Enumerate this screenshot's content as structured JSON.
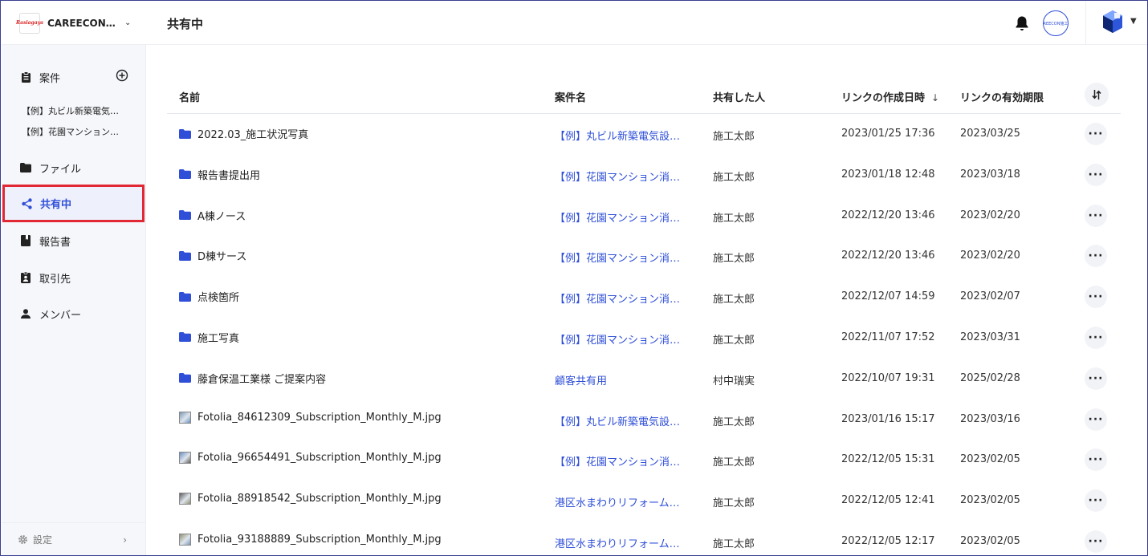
{
  "org": {
    "logo_text": "Rasiagaya",
    "name": "CAREECON 施…"
  },
  "sidebar": {
    "projects_label": "案件",
    "sub_items": [
      "【例】丸ビル新築電気設…",
      "【例】花園マンション…"
    ],
    "files_label": "ファイル",
    "shared_label": "共有中",
    "reports_label": "報告書",
    "clients_label": "取引先",
    "members_label": "メンバー",
    "settings_label": "設定"
  },
  "header": {
    "title": "共有中",
    "company_badge": "REECON施工"
  },
  "table": {
    "columns": [
      "名前",
      "案件名",
      "共有した人",
      "リンクの作成日時",
      "リンクの有効期限"
    ],
    "sort_indicator": "↓",
    "rows": [
      {
        "type": "folder",
        "name": "2022.03_施工状況写真",
        "project": "【例】丸ビル新築電気設備…",
        "shared_by": "施工太郎",
        "created": "2023/01/25 17:36",
        "expires": "2023/03/25"
      },
      {
        "type": "folder",
        "name": "報告書提出用",
        "project": "【例】花園マンション消防…",
        "shared_by": "施工太郎",
        "created": "2023/01/18 12:48",
        "expires": "2023/03/18"
      },
      {
        "type": "folder",
        "name": "A棟ノース",
        "project": "【例】花園マンション消防…",
        "shared_by": "施工太郎",
        "created": "2022/12/20 13:46",
        "expires": "2023/02/20"
      },
      {
        "type": "folder",
        "name": "D棟サース",
        "project": "【例】花園マンション消防…",
        "shared_by": "施工太郎",
        "created": "2022/12/20 13:46",
        "expires": "2023/02/20"
      },
      {
        "type": "folder",
        "name": "点検箇所",
        "project": "【例】花園マンション消防…",
        "shared_by": "施工太郎",
        "created": "2022/12/07 14:59",
        "expires": "2023/02/07"
      },
      {
        "type": "folder",
        "name": "施工写真",
        "project": "【例】花園マンション消防…",
        "shared_by": "施工太郎",
        "created": "2022/11/07 17:52",
        "expires": "2023/03/31"
      },
      {
        "type": "folder",
        "name": "藤倉保温工業様 ご提案内容",
        "project": "顧客共有用",
        "shared_by": "村中瑞実",
        "created": "2022/10/07 19:31",
        "expires": "2025/02/28"
      },
      {
        "type": "image",
        "name": "Fotolia_84612309_Subscription_Monthly_M.jpg",
        "project": "【例】丸ビル新築電気設備…",
        "shared_by": "施工太郎",
        "created": "2023/01/16 15:17",
        "expires": "2023/03/16"
      },
      {
        "type": "image",
        "name": "Fotolia_96654491_Subscription_Monthly_M.jpg",
        "project": "【例】花園マンション消防…",
        "shared_by": "施工太郎",
        "created": "2022/12/05 15:31",
        "expires": "2023/02/05"
      },
      {
        "type": "image",
        "name": "Fotolia_88918542_Subscription_Monthly_M.jpg",
        "project": "港区水まわりリフォーム工事",
        "shared_by": "施工太郎",
        "created": "2022/12/05 12:41",
        "expires": "2023/02/05"
      },
      {
        "type": "image",
        "name": "Fotolia_93188889_Subscription_Monthly_M.jpg",
        "project": "港区水まわりリフォーム工事",
        "shared_by": "施工太郎",
        "created": "2022/12/05 12:17",
        "expires": "2023/02/05"
      }
    ]
  },
  "colors": {
    "accent": "#2f4fd8",
    "active_outline": "#e22834",
    "sidebar_bg": "#f6f7fb"
  },
  "icons": [
    "clipboard-icon",
    "plus-circle-icon",
    "folder-icon",
    "share-icon",
    "book-icon",
    "contact-icon",
    "person-icon",
    "gear-icon",
    "bell-icon",
    "cube-icon",
    "sort-toggle-icon",
    "more-icon"
  ]
}
